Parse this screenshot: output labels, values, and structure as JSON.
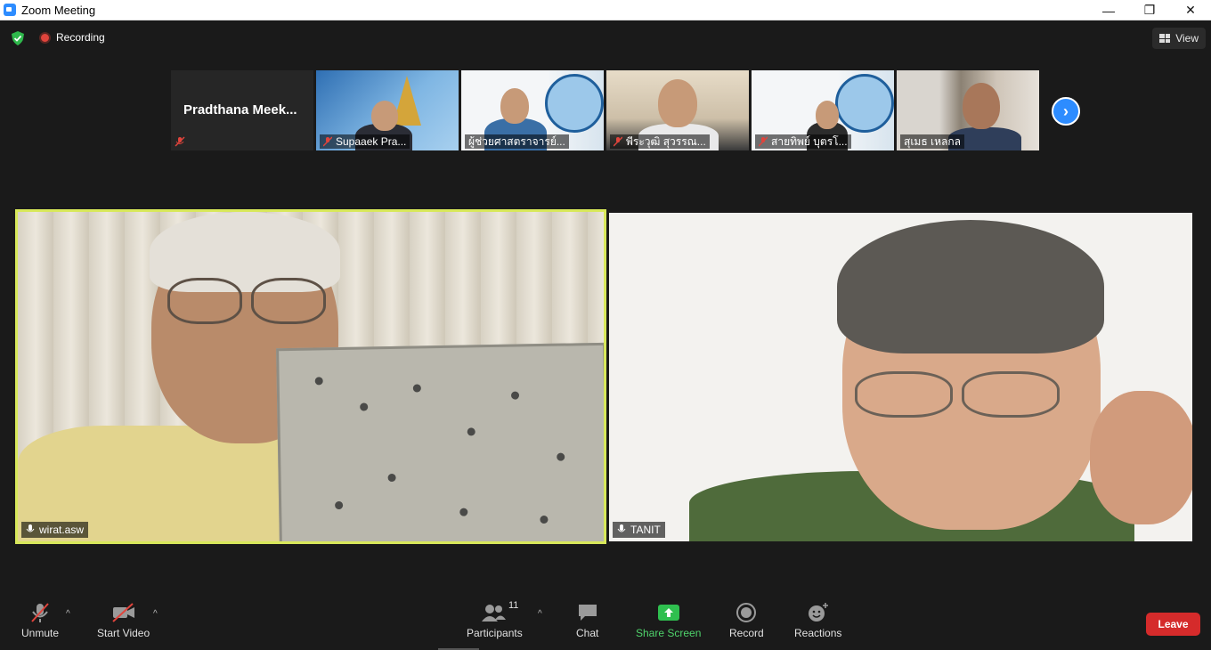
{
  "window": {
    "title": "Zoom Meeting",
    "controls": {
      "minimize": "—",
      "restore": "❐",
      "close": "✕"
    }
  },
  "topbar": {
    "recording_label": "Recording",
    "view_label": "View"
  },
  "thumbnails": [
    {
      "name": "Pradthana  Meek...",
      "muted": true,
      "video": false
    },
    {
      "name": "Supaaek Pra...",
      "muted": true,
      "video": true
    },
    {
      "name": "ผู้ช่วยศาสตราจารย์...",
      "muted": false,
      "video": true
    },
    {
      "name": "พีระวุฒิ สุวรรณ...",
      "muted": true,
      "video": true
    },
    {
      "name": "สายทิพย์  บุตรโ...",
      "muted": true,
      "video": true
    },
    {
      "name": "สุเมธ เหลกล",
      "muted": false,
      "video": true
    }
  ],
  "next_page_icon": "›",
  "main_tiles": [
    {
      "name": "wirat.asw",
      "active_speaker": true
    },
    {
      "name": "TANIT",
      "active_speaker": false
    }
  ],
  "toolbar": {
    "unmute": "Unmute",
    "start_video": "Start Video",
    "participants": "Participants",
    "participants_count": "11",
    "chat": "Chat",
    "share_screen": "Share Screen",
    "record": "Record",
    "reactions": "Reactions",
    "leave": "Leave",
    "caret": "^"
  },
  "colors": {
    "accent": "#2d8cff",
    "share_green": "#4fd36b",
    "leave_red": "#d52b2b",
    "speaker_border": "#d8e85a",
    "mute_red": "#e0443c"
  }
}
